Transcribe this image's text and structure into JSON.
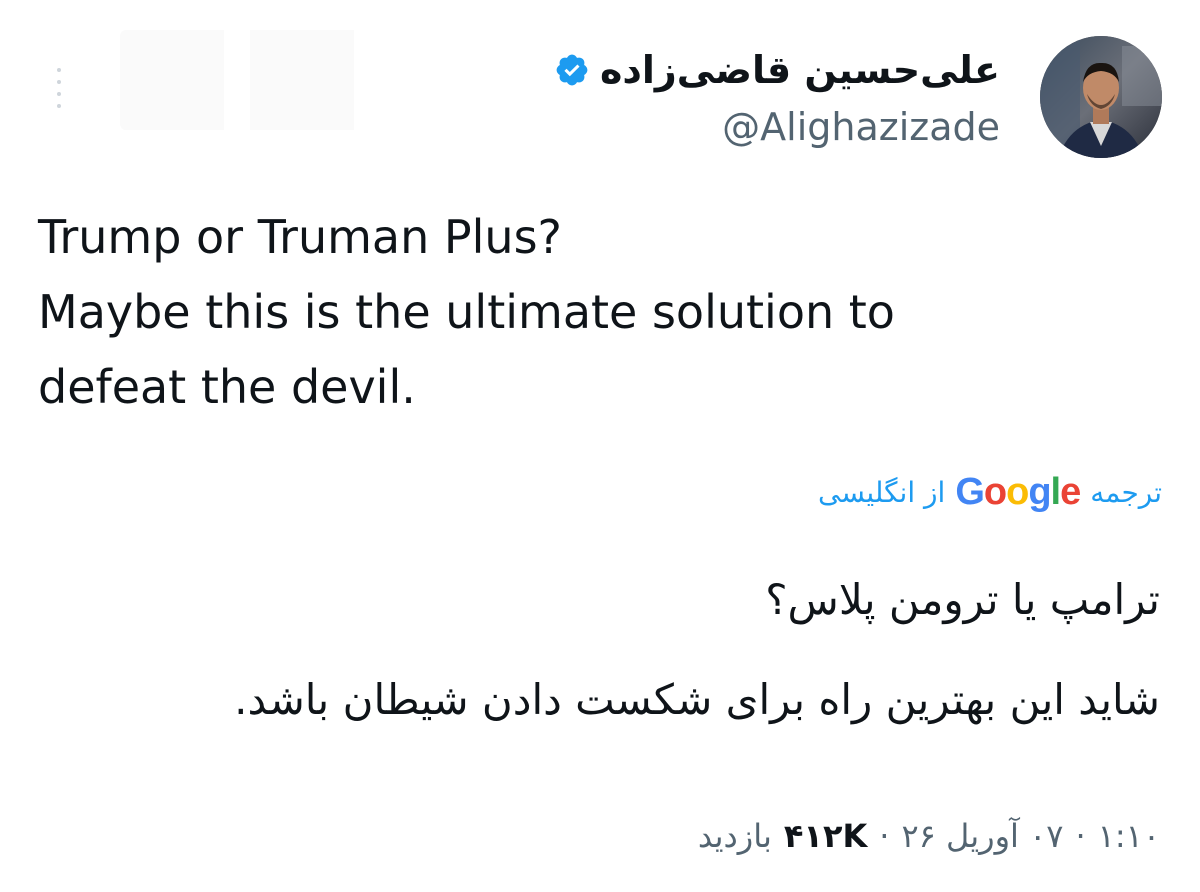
{
  "author": {
    "display_name": "علی‌حسین قاضی‌زاده",
    "handle": "@Alighazizade",
    "verified_icon": "verified-badge-icon",
    "avatar": "profile-photo"
  },
  "tweet": {
    "lines": [
      "Trump or Truman Plus?",
      "Maybe this is the ultimate solution to",
      "defeat the devil."
    ]
  },
  "translation": {
    "label_before": "ترجمه",
    "provider": "Google",
    "label_after": "از انگلیسی",
    "lines": [
      "ترامپ یا ترومن پلاس؟",
      "شاید این بهترین راه برای شکست دادن شیطان باشد."
    ]
  },
  "meta": {
    "time": "۱:۱۰",
    "date": "۰۷ آوریل ۲۶",
    "views_count": "۴۱۲K",
    "views_label": "بازدید",
    "separator": "·"
  },
  "colors": {
    "link": "#1d9bf0",
    "secondary": "#536471",
    "primary": "#0f1419"
  }
}
